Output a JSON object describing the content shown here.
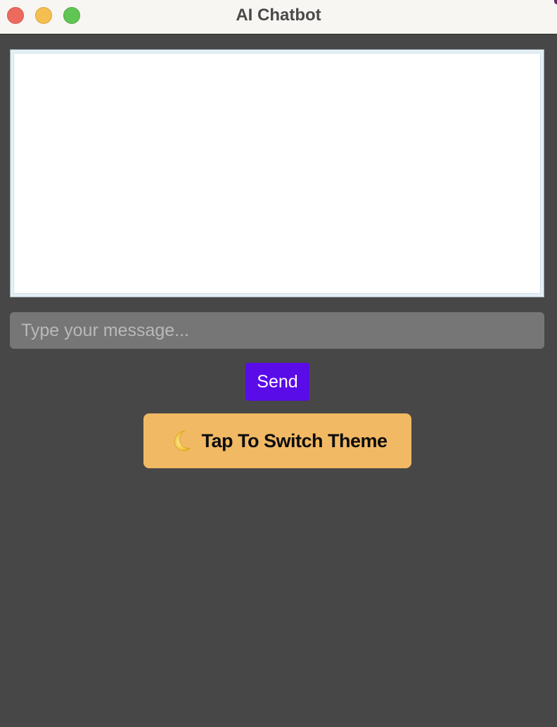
{
  "window": {
    "title": "AI Chatbot"
  },
  "chat": {
    "messages": []
  },
  "composer": {
    "placeholder": "Type your message...",
    "value": "",
    "send_label": "Send"
  },
  "theme_toggle": {
    "icon": "moon-icon",
    "label": "Tap To Switch Theme"
  },
  "colors": {
    "background": "#474747",
    "send_button": "#5a0ce8",
    "theme_button": "#f2b964",
    "input_background": "#767676"
  }
}
